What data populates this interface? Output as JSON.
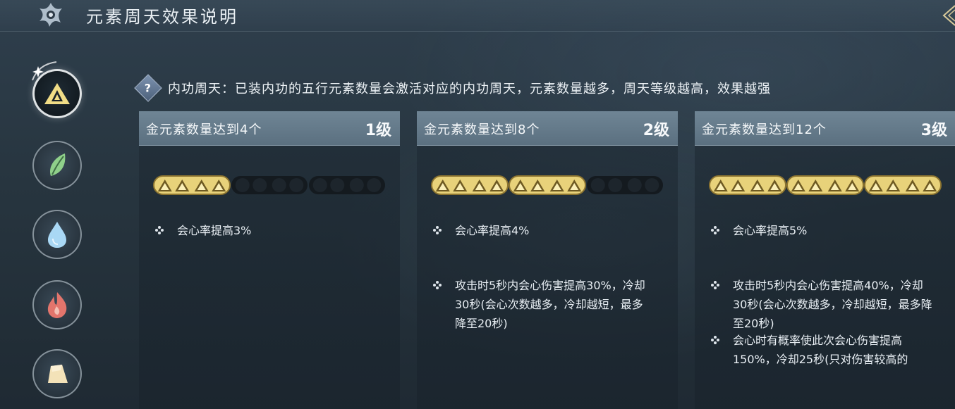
{
  "header": {
    "title": "元素周天效果说明"
  },
  "sidebar": {
    "items": [
      {
        "element": "金",
        "icon": "gold-triangle-icon",
        "active": true
      },
      {
        "element": "木",
        "icon": "leaf-icon",
        "active": false
      },
      {
        "element": "水",
        "icon": "water-drop-icon",
        "active": false
      },
      {
        "element": "火",
        "icon": "flame-icon",
        "active": false
      },
      {
        "element": "土",
        "icon": "earth-rock-icon",
        "active": false
      }
    ]
  },
  "help": {
    "icon": "question-icon",
    "symbol": "?",
    "text": "内功周天：已装内功的五行元素数量会激活对应的内功周天，元素数量越多，周天等级越高，效果越强"
  },
  "cards": [
    {
      "title": "金元素数量达到4个",
      "level": "1级",
      "filled": 4,
      "total": 12,
      "effects": [
        "会心率提高3%"
      ]
    },
    {
      "title": "金元素数量达到8个",
      "level": "2级",
      "filled": 8,
      "total": 12,
      "effects": [
        "会心率提高4%",
        "攻击时5秒内会心伤害提高30%，冷却30秒(会心次数越多，冷却越短，最多降至20秒)"
      ]
    },
    {
      "title": "金元素数量达到12个",
      "level": "3级",
      "filled": 12,
      "total": 12,
      "effects": [
        "会心率提高5%",
        "攻击时5秒内会心伤害提高40%，冷却30秒(会心次数越多，冷却越短，最多降至20秒)",
        "会心时有概率使此次会心伤害提高150%，冷却25秒(只对伤害较高的"
      ]
    }
  ],
  "colors": {
    "gold": "#e8d27a",
    "gold_dark": "#8c7430",
    "empty_slot": "#141a1f",
    "header_bg": "#6a8090"
  }
}
